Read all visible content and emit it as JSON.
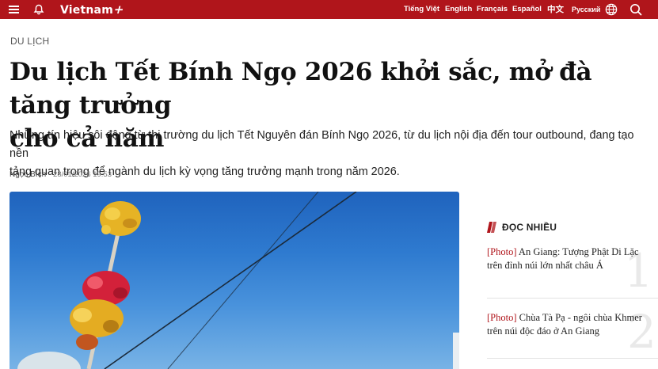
{
  "header": {
    "logo_text": "Vietnam",
    "logo_plus": "+",
    "languages": [
      "Tiếng Việt",
      "English",
      "Français",
      "Español",
      "中文",
      "Русский"
    ],
    "icons": [
      "menu-icon",
      "bell-icon",
      "globe-icon",
      "search-icon"
    ],
    "bar_color": "#b0151b"
  },
  "article": {
    "category": "DU LỊCH",
    "title_line1": "Du lịch Tết Bính Ngọ 2026 khởi sắc, mở đà tăng trưởng",
    "title_line2": "cho cả năm",
    "sapo_line1": "Những tín hiệu sôi động từ thị trường du lịch Tết Nguyên đán Bính Ngọ 2026, từ du lịch nội địa đến tour outbound, đang tạo nền",
    "sapo_line2": "tảng quan trọng để ngành du lịch kỳ vọng tăng trưởng mạnh trong năm 2026.",
    "author": "Ngọc Bích",
    "separator": " - ",
    "datetime": "28/01/2026 19:53"
  },
  "sidebar": {
    "heading": "ĐỌC NHIỀU",
    "items": [
      {
        "number": "1",
        "tag": "[Photo]",
        "text": " An Giang: Tượng Phật Di Lặc trên đỉnh núi lớn nhất châu Á"
      },
      {
        "number": "2",
        "tag": "[Photo]",
        "text": " Chùa Tà Pạ - ngôi chùa Khmer trên núi độc đáo ở An Giang"
      }
    ]
  }
}
